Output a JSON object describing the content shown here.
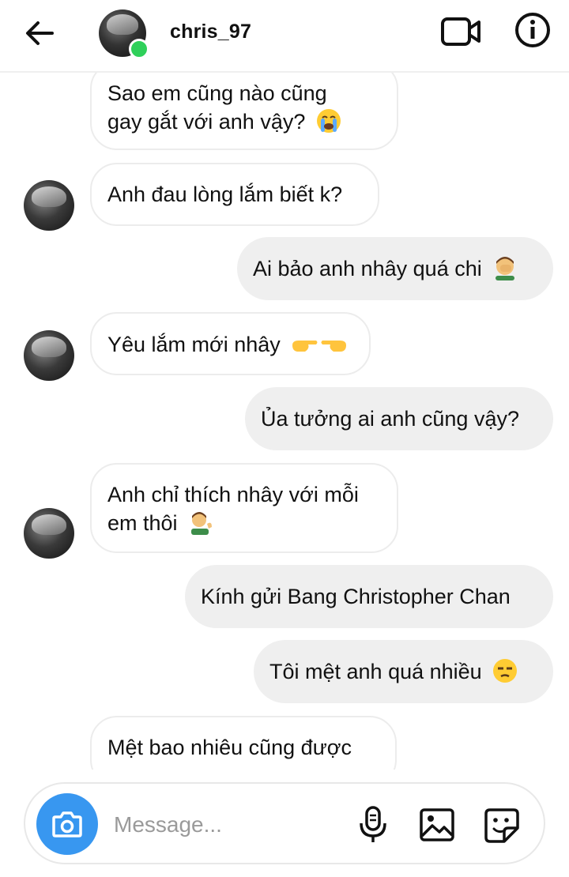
{
  "header": {
    "username": "chris_97",
    "online_color": "#2fd05a",
    "icons": [
      "arrow-left-icon",
      "video-call-icon",
      "info-icon"
    ]
  },
  "messages": [
    {
      "side": "in",
      "lines": [
        "Sao em cũng nào cũng",
        "gay gắt với anh vậy?"
      ],
      "emoji": "loudly-crying-face"
    },
    {
      "side": "in",
      "lines": [
        "Anh đau lòng lắm biết k?"
      ],
      "emoji": ""
    },
    {
      "side": "out",
      "lines": [
        "Ai bảo anh nhây quá chi"
      ],
      "emoji": "man-facepalming"
    },
    {
      "side": "in",
      "lines": [
        "Yêu lắm mới nhây"
      ],
      "emoji": "pointing-hands"
    },
    {
      "side": "out",
      "lines": [
        "Ủa tưởng ai anh cũng vậy?"
      ],
      "emoji": ""
    },
    {
      "side": "in",
      "lines": [
        "Anh chỉ thích nhây với mỗi",
        "em thôi"
      ],
      "emoji": "man-tipping-hand"
    },
    {
      "side": "out",
      "lines": [
        "Kính gửi Bang Christopher Chan"
      ],
      "emoji": ""
    },
    {
      "side": "out",
      "lines": [
        "Tôi mệt anh quá nhiều"
      ],
      "emoji": "unamused-face"
    },
    {
      "side": "in",
      "lines": [
        "Mệt bao nhiêu cũng được"
      ],
      "emoji": ""
    }
  ],
  "composer": {
    "placeholder": "Message...",
    "accent": "#3897f0",
    "icons": [
      "camera-icon",
      "microphone-icon",
      "image-icon",
      "sticker-icon"
    ]
  }
}
